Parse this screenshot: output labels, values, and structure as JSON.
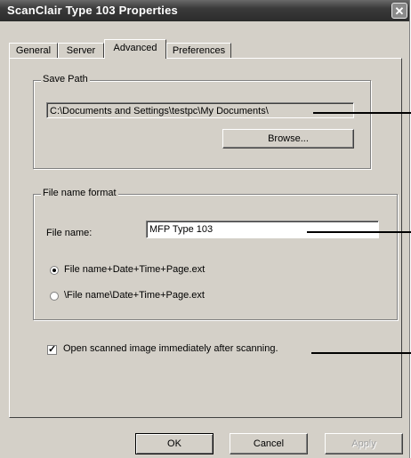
{
  "window": {
    "title": "ScanClair Type 103 Properties",
    "close_glyph": "✕"
  },
  "tabs": [
    {
      "label": "General"
    },
    {
      "label": "Server"
    },
    {
      "label": "Advanced"
    },
    {
      "label": "Preferences"
    }
  ],
  "save_path": {
    "legend": "Save Path",
    "path_value": "C:\\Documents and Settings\\testpc\\My Documents\\",
    "browse_label": "Browse..."
  },
  "file_name_format": {
    "legend": "File name format",
    "file_name_label": "File name:",
    "file_name_value": "MFP Type 103",
    "option1_label": "File name+Date+Time+Page.ext",
    "option2_label": "\\File name\\Date+Time+Page.ext",
    "selected_option": 1
  },
  "open_after_scan": {
    "label": "Open scanned image immediately after scanning.",
    "checked": true
  },
  "buttons": {
    "ok": "OK",
    "cancel": "Cancel",
    "apply": "Apply"
  },
  "icons": {
    "close": "close-icon",
    "radio_selected": "radio-selected-icon",
    "radio_unselected": "radio-unselected-icon",
    "checkmark": "checkmark-icon"
  }
}
